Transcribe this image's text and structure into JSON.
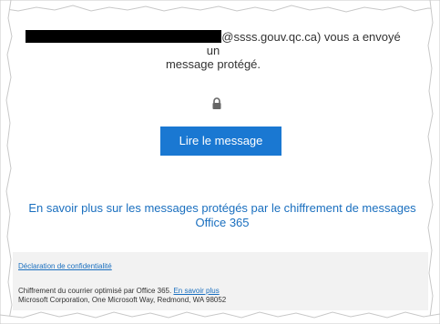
{
  "message": {
    "sender_suffix": "@ssss.gouv.qc.ca) vous a envoyé un",
    "sender_second_line": "message protégé."
  },
  "icons": {
    "lock": "lock-icon"
  },
  "read_button": {
    "label": "Lire le message"
  },
  "info": {
    "learn_more_text": "En savoir plus sur les messages protégés par le chiffrement de messages Office 365"
  },
  "footer": {
    "privacy_link": "Déclaration de confidentialité",
    "encryption_text": "Chiffrement du courrier optimisé par Office 365.",
    "learn_more_link": "En savoir plus",
    "address": "Microsoft Corporation, One Microsoft Way, Redmond, WA 98052"
  },
  "colors": {
    "button_bg": "#1a78d2",
    "link": "#1a6fbf",
    "footer_bg": "#f2f2f2",
    "redaction": "#000000"
  }
}
